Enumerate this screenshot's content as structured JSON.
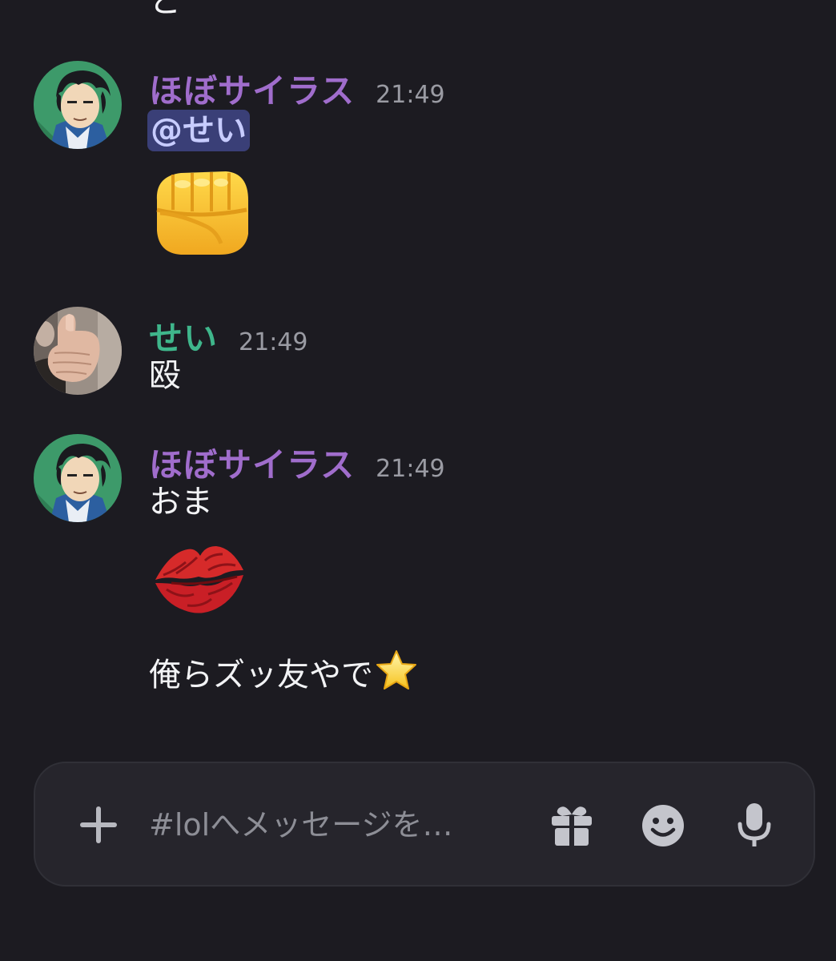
{
  "channel": {
    "cut_message_text": "と"
  },
  "messages": [
    {
      "username": "ほぼサイラス",
      "time": "21:49",
      "mention": "@せい",
      "emoji": "oncoming-fist"
    },
    {
      "username": "せい",
      "time": "21:49",
      "text": "殴"
    },
    {
      "username": "ほぼサイラス",
      "time": "21:49",
      "lines": [
        "おま",
        "俺らズッ友やで"
      ],
      "emoji": "kiss-mark",
      "trailing_emoji": "star"
    }
  ],
  "composer": {
    "placeholder": "#lolへメッセージを…"
  },
  "icons": {
    "add": "plus-icon",
    "gift": "gift-icon",
    "emoji": "smiley-icon",
    "voice": "microphone-icon"
  },
  "colors": {
    "background": "#1c1b21",
    "username_purple": "#a06dcc",
    "username_teal": "#3fb68b",
    "mention_bg": "#3a3f77",
    "mention_text": "#c7ccff"
  }
}
